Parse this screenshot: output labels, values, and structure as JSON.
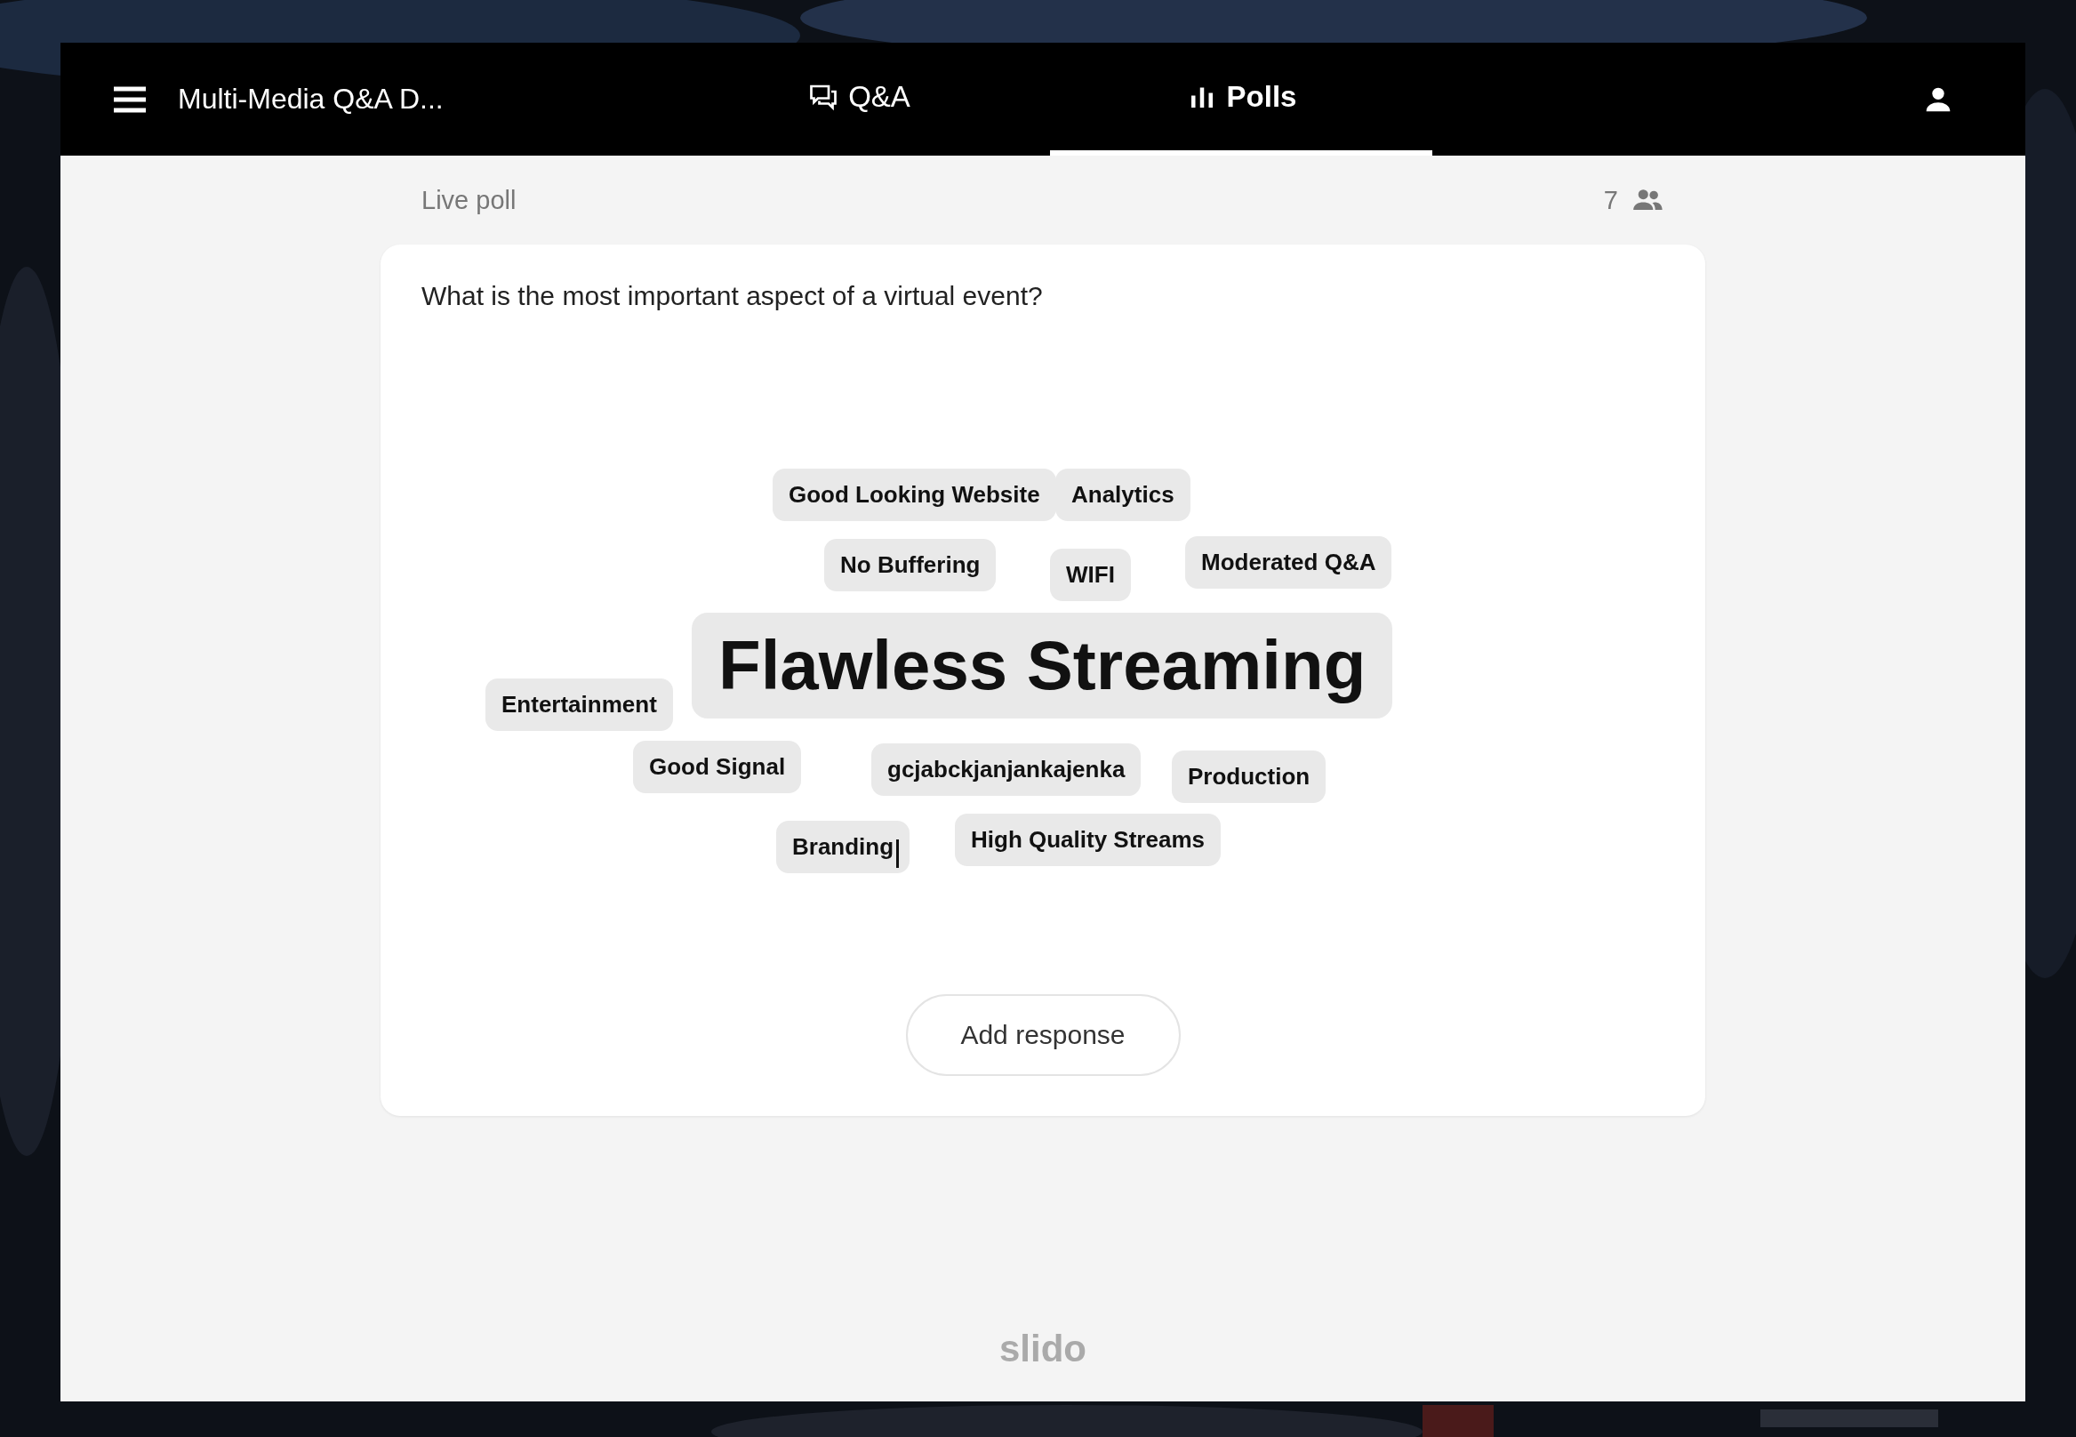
{
  "header": {
    "title": "Multi-Media Q&A D...",
    "tabs": [
      {
        "label": "Q&A",
        "kind": "qa",
        "selected": false
      },
      {
        "label": "Polls",
        "kind": "polls",
        "selected": true
      }
    ]
  },
  "poll": {
    "status": "Live poll",
    "participants": "7",
    "question": "What is the most important aspect of a virtual event?",
    "words": [
      {
        "text": "Good Looking Website",
        "kind": "regular"
      },
      {
        "text": "Analytics",
        "kind": "regular"
      },
      {
        "text": "No Buffering",
        "kind": "regular"
      },
      {
        "text": "WIFI",
        "kind": "regular"
      },
      {
        "text": "Moderated Q&A",
        "kind": "regular"
      },
      {
        "text": "Entertainment",
        "kind": "regular"
      },
      {
        "text": "Flawless Streaming",
        "kind": "top"
      },
      {
        "text": "Good Signal",
        "kind": "regular"
      },
      {
        "text": "gcjabckjanjankajenka",
        "kind": "regular"
      },
      {
        "text": "Production",
        "kind": "regular"
      },
      {
        "text": "Branding",
        "kind": "regular"
      },
      {
        "text": "High Quality Streams",
        "kind": "regular"
      }
    ],
    "button": "Add response"
  },
  "footer": {
    "logo": "slido"
  }
}
